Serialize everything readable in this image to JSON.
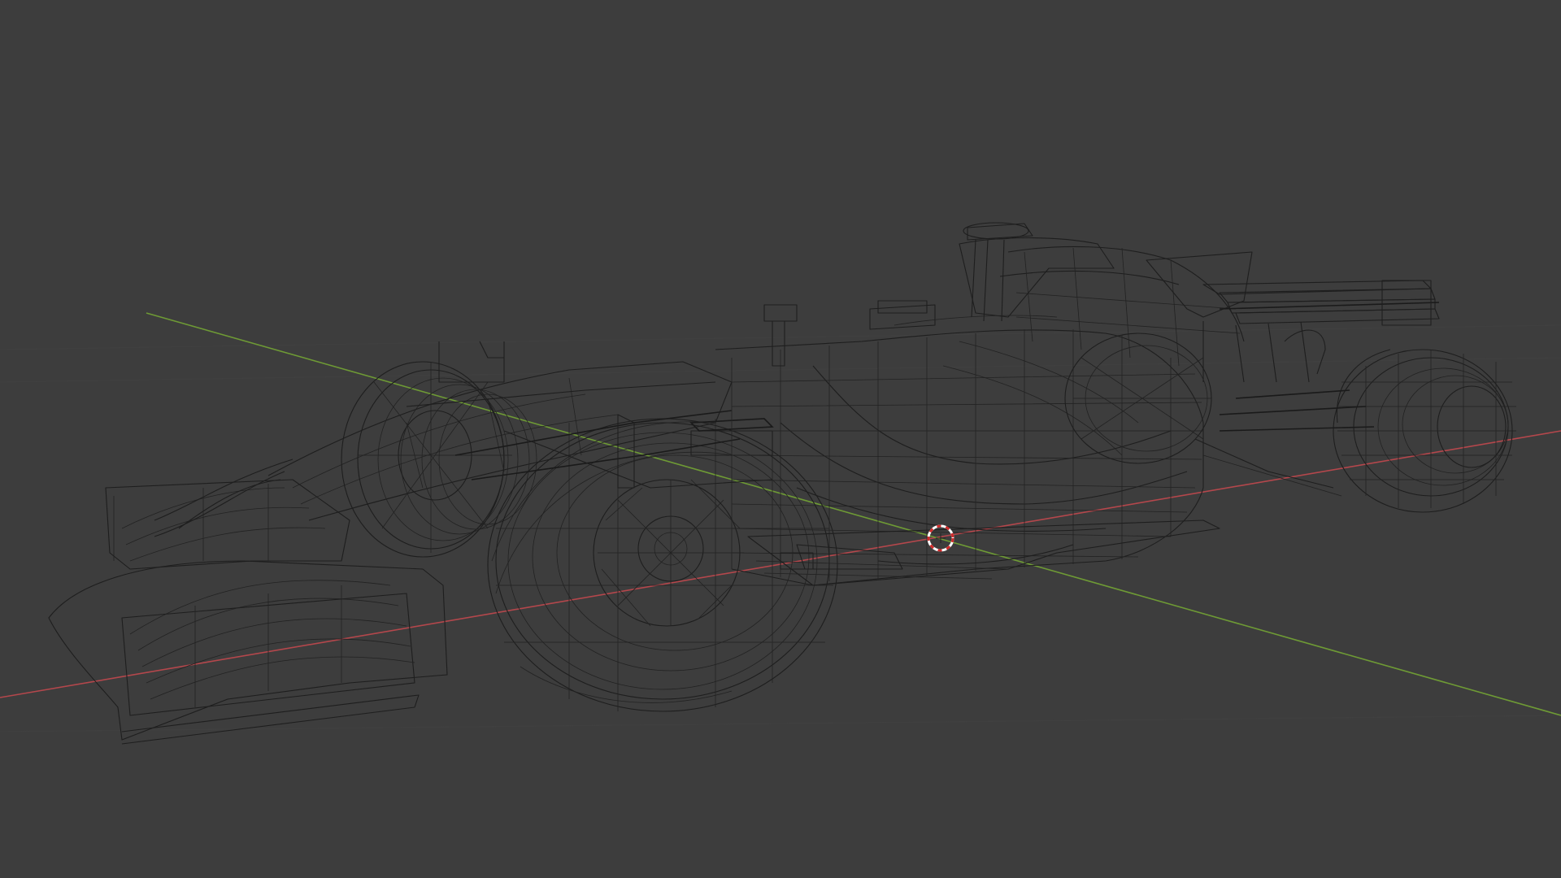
{
  "viewport": {
    "background": "#3d3d3d",
    "shading_mode": "wireframe",
    "wire_color": "#1e1e1e",
    "x_axis_color": "#b4474c",
    "y_axis_color": "#6e9a35",
    "object": "race-car-model"
  },
  "cursor_3d": {
    "icon": "3d-cursor-icon",
    "ring_colors": [
      "#ffffff",
      "#d02a2a"
    ]
  }
}
